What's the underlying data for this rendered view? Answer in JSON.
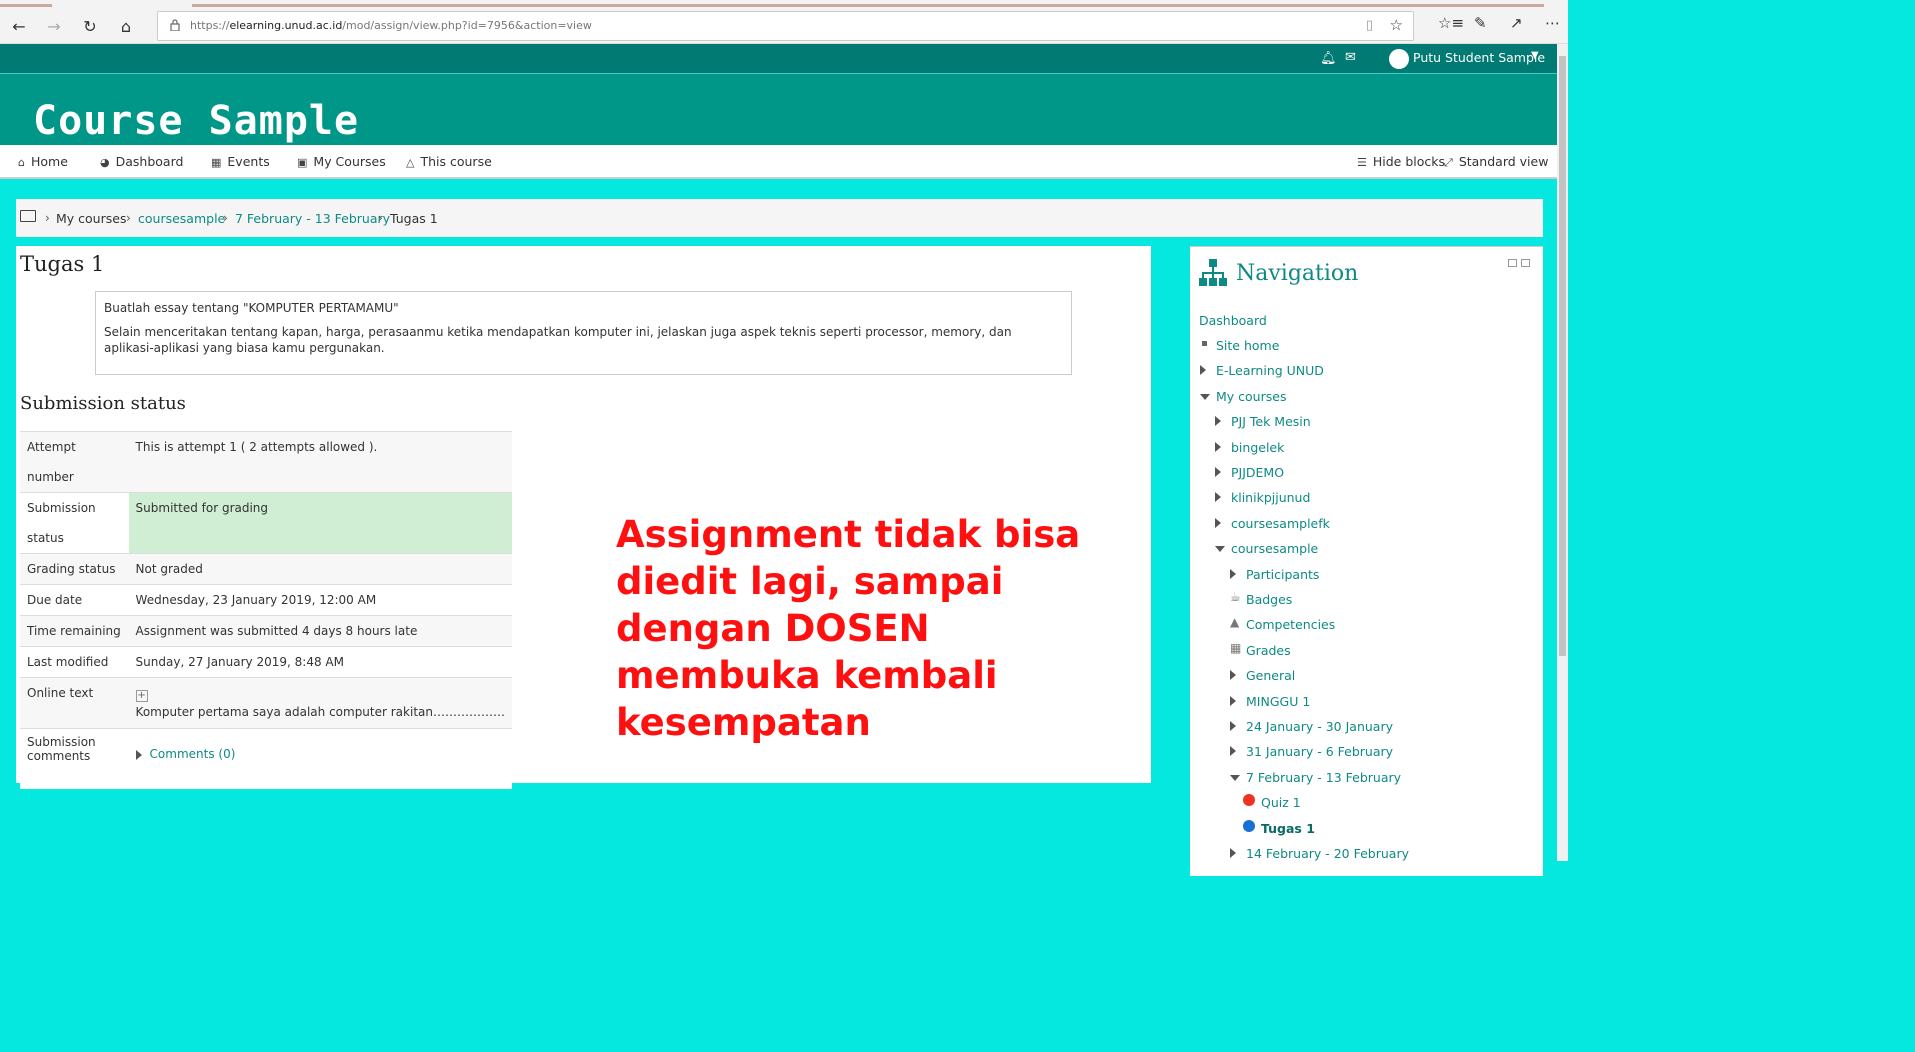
{
  "browser": {
    "url_prefix": "https://",
    "url_host": "elearning.unud.ac.id",
    "url_path": "/mod/assign/view.php?id=7956&action=view"
  },
  "header": {
    "user_name": "Putu Student Sample",
    "site_title": "Course Sample"
  },
  "navbar": {
    "home": "Home",
    "dashboard": "Dashboard",
    "events": "Events",
    "my_courses": "My Courses",
    "this_course": "This course",
    "hide_blocks": "Hide blocks",
    "standard_view": "Standard view"
  },
  "breadcrumb": [
    "My courses",
    "coursesample",
    "7 February - 13 February",
    "Tugas 1"
  ],
  "page_title": "Tugas 1",
  "intro": {
    "line1": "Buatlah essay tentang \"KOMPUTER PERTAMAMU\"",
    "line2": "Selain menceritakan tentang kapan, harga, perasaanmu ketika mendapatkan komputer ini, jelaskan juga aspek teknis seperti processor, memory, dan aplikasi-aplikasi yang biasa kamu pergunakan."
  },
  "submission": {
    "heading": "Submission status",
    "rows": [
      {
        "label": "Attempt number",
        "value": "This is attempt 1 ( 2 attempts allowed )."
      },
      {
        "label": "Submission status",
        "value": "Submitted for grading"
      },
      {
        "label": "Grading status",
        "value": "Not graded"
      },
      {
        "label": "Due date",
        "value": "Wednesday, 23 January 2019, 12:00 AM"
      },
      {
        "label": "Time remaining",
        "value": "Assignment was submitted 4 days 8 hours late"
      },
      {
        "label": "Last modified",
        "value": "Sunday, 27 January 2019, 8:48 AM"
      },
      {
        "label": "Online text",
        "value": "Komputer pertama saya adalah computer rakitan………………"
      },
      {
        "label": "Submission comments",
        "value": "Comments (0)"
      }
    ]
  },
  "annotation": "Assignment tidak bisa diedit lagi, sampai dengan DOSEN membuka kembali kesempatan",
  "navigation_block": {
    "title": "Navigation",
    "items": [
      "Dashboard",
      "Site home",
      "E-Learning UNUD",
      "My courses",
      "PJJ Tek Mesin",
      "bingelek",
      "PJJDEMO",
      "klinikpjjunud",
      "coursesamplefk",
      "coursesample",
      "Participants",
      "Badges",
      "Competencies",
      "Grades",
      "General",
      "MINGGU 1",
      "24 January - 30 January",
      "31 January - 6 February",
      "7 February - 13 February",
      "Quiz 1",
      "Tugas 1",
      "14 February - 20 February"
    ]
  },
  "colors": {
    "page_background": "#05e8e0",
    "header_dark": "#007a72",
    "header": "#009688",
    "link": "#0e8a84",
    "annotation": "#ff1010",
    "submitted_highlight": "#cfeed3"
  }
}
